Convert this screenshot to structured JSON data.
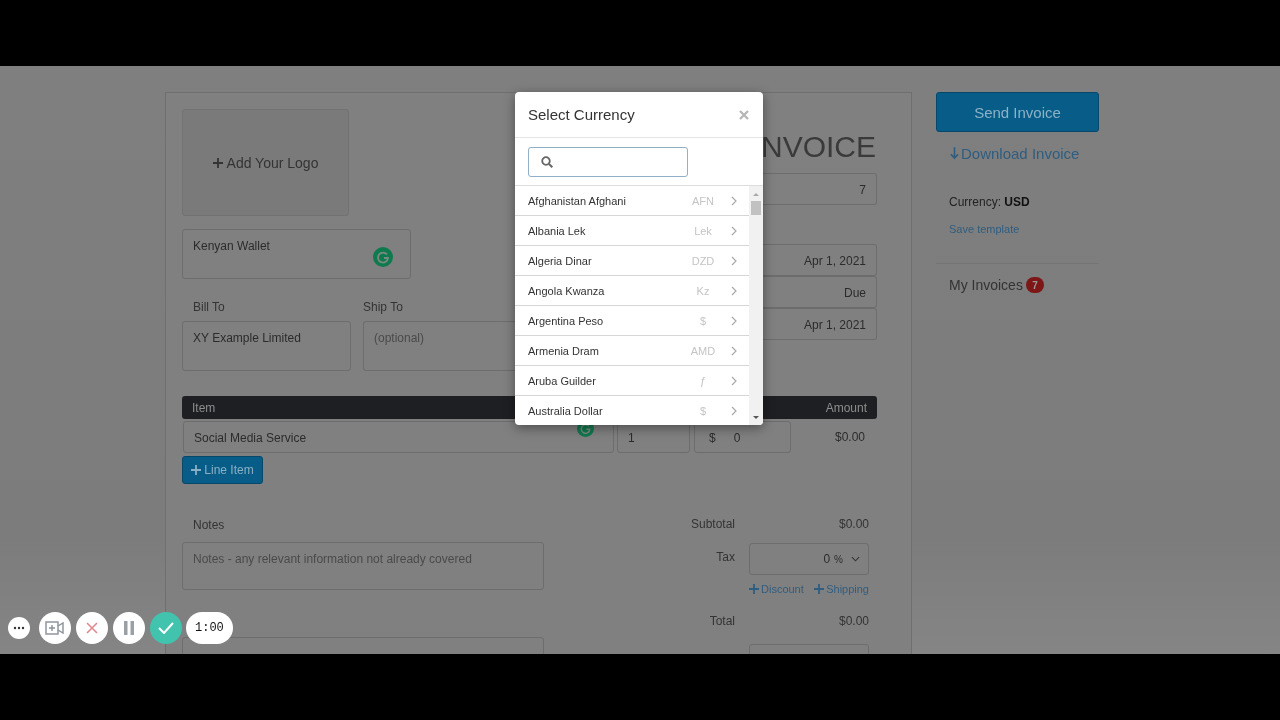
{
  "invoice": {
    "logo_button": "Add Your Logo",
    "from": "Kenyan Wallet",
    "bill_to": {
      "label": "Bill To",
      "value": "XY Example Limited"
    },
    "ship_to": {
      "label": "Ship To",
      "placeholder": "(optional)"
    },
    "title": "NVOICE",
    "number": "7",
    "date": "Apr 1, 2021",
    "payment_terms": "Due",
    "due_date": "Apr 1, 2021",
    "items": {
      "columns": [
        "Item",
        "Amount"
      ],
      "rows": [
        {
          "description": "Social Media Service",
          "quantity": "1",
          "currency": "$",
          "rate": "0",
          "amount": "$0.00"
        }
      ]
    },
    "add_line": "Line Item",
    "notes": {
      "label": "Notes",
      "placeholder": "Notes - any relevant information not already covered"
    },
    "totals": {
      "subtotal_label": "Subtotal",
      "subtotal": "$0.00",
      "tax_label": "Tax",
      "tax_value": "0",
      "tax_unit": "%",
      "discount": "Discount",
      "shipping": "Shipping",
      "total_label": "Total",
      "total": "$0.00"
    }
  },
  "sidebar": {
    "send": "Send Invoice",
    "download": "Download Invoice",
    "currency": "Currency: **USD**",
    "save_template": "Save template",
    "my_invoices": "My Invoices",
    "invoice_count": "7"
  },
  "modal": {
    "title": "Select Currency",
    "currencies": [
      {
        "name": "Afghanistan Afghani",
        "code": "AFN"
      },
      {
        "name": "Albania Lek",
        "code": "Lek"
      },
      {
        "name": "Algeria Dinar",
        "code": "DZD"
      },
      {
        "name": "Angola Kwanza",
        "code": "Kz"
      },
      {
        "name": "Argentina Peso",
        "code": "$"
      },
      {
        "name": "Armenia Dram",
        "code": "AMD"
      },
      {
        "name": "Aruba Guilder",
        "code": "ƒ"
      },
      {
        "name": "Australia Dollar",
        "code": "$"
      }
    ]
  },
  "recorder": {
    "buttons": [
      {
        "kind": "more"
      },
      {
        "kind": "camera"
      },
      {
        "kind": "cancel"
      },
      {
        "kind": "pause"
      },
      {
        "kind": "done"
      }
    ],
    "timer": "1:00"
  }
}
